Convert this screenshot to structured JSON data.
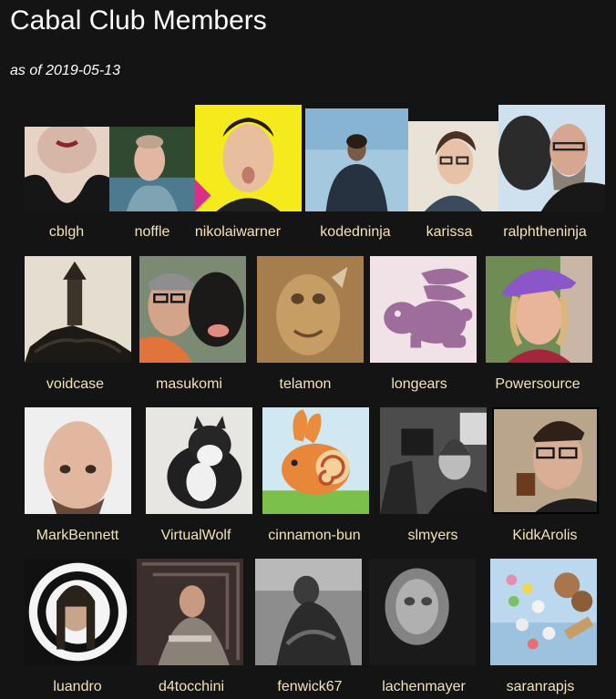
{
  "title": "Cabal Club Members",
  "subtitle": "as of 2019-05-13",
  "colors": {
    "background": "#141414",
    "name_text": "#f4e2b7",
    "heading_text": "#ffffff"
  },
  "members": [
    {
      "name": "cblgh",
      "avatar": "face-closeup-photo"
    },
    {
      "name": "noffle",
      "avatar": "selfie-forest-photo"
    },
    {
      "name": "nikolaiwarner",
      "avatar": "yellow-background-portrait"
    },
    {
      "name": "kodedninja",
      "avatar": "person-sky-photo"
    },
    {
      "name": "karissa",
      "avatar": "glasses-portrait"
    },
    {
      "name": "ralphtheninja",
      "avatar": "man-with-dog-photo"
    },
    {
      "name": "voidcase",
      "avatar": "tower-sketch"
    },
    {
      "name": "masukomi",
      "avatar": "man-with-black-dog-photo"
    },
    {
      "name": "telamon",
      "avatar": "painted-creature"
    },
    {
      "name": "longears",
      "avatar": "purple-rabbit-icon"
    },
    {
      "name": "Powersource",
      "avatar": "purple-hat-portrait"
    },
    {
      "name": "MarkBennett",
      "avatar": "bald-man-photo"
    },
    {
      "name": "VirtualWolf",
      "avatar": "fluffy-cat-photo"
    },
    {
      "name": "cinnamon-bun",
      "avatar": "snail-bunny-illustration"
    },
    {
      "name": "slmyers",
      "avatar": "camera-crew-photo"
    },
    {
      "name": "KidkArolis",
      "avatar": "man-drinking-photo"
    },
    {
      "name": "luandro",
      "avatar": "spiral-portrait"
    },
    {
      "name": "d4tocchini",
      "avatar": "seated-man-photo"
    },
    {
      "name": "fenwick67",
      "avatar": "bird-sculpture-photo"
    },
    {
      "name": "lachenmayer",
      "avatar": "blurry-face-photo"
    },
    {
      "name": "saranrapjs",
      "avatar": "cookies-photo"
    }
  ]
}
